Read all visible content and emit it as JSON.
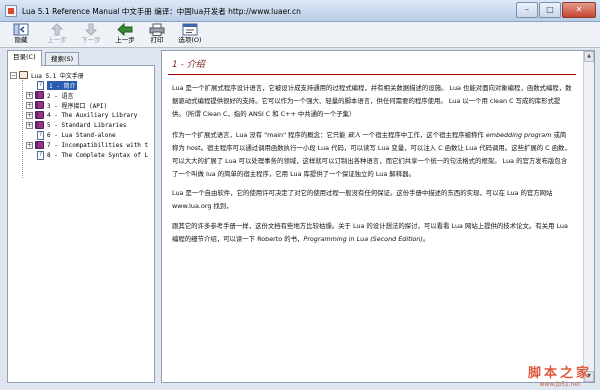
{
  "window": {
    "title": "Lua 5.1 Reference Manual 中文手册 编译：中国lua开发者 http://www.luaer.cn",
    "minimize": "–",
    "maximize": "□",
    "close": "✕"
  },
  "toolbar": {
    "items": [
      {
        "label": "隐藏",
        "icon": "hide-icon",
        "enabled": true
      },
      {
        "label": "上一步",
        "icon": "up-arrow-icon",
        "enabled": false
      },
      {
        "label": "下一步",
        "icon": "down-arrow-icon",
        "enabled": false
      },
      {
        "label": "上一步",
        "icon": "back-arrow-icon",
        "enabled": true
      },
      {
        "label": "打印",
        "icon": "print-icon",
        "enabled": true
      },
      {
        "label": "选项(O)",
        "icon": "options-icon",
        "enabled": true
      }
    ]
  },
  "nav": {
    "tabs": [
      {
        "label": "目录(C)"
      },
      {
        "label": "搜索(S)"
      }
    ],
    "tree": [
      {
        "label": "Lua 5.1 中文手册",
        "type": "root"
      },
      {
        "label": "1 - 简介",
        "type": "page",
        "selected": true
      },
      {
        "label": "2 - 语言",
        "type": "book"
      },
      {
        "label": "3 - 程序接口 (API)",
        "type": "book"
      },
      {
        "label": "4 - The Auxiliary Library",
        "type": "book"
      },
      {
        "label": "5 - Standard Libraries",
        "type": "book"
      },
      {
        "label": "6 - Lua Stand-alone",
        "type": "page"
      },
      {
        "label": "7 - Incompatibilities with t",
        "type": "book"
      },
      {
        "label": "8 - The Complete Syntax of L",
        "type": "page"
      }
    ]
  },
  "content": {
    "heading": "1 - 介绍",
    "p1": "Lua 是一个扩展式程序设计语言，它被设计成支持通用的过程式编程，并有相关数据描述的设施。 Lua 也能对面向对象编程，函数式编程，数据驱动式编程提供很好的支持。它可以作为一个强大、轻量的脚本语言，供任何需要的程序使用。 Lua 以一个用 clean C 写成的库形式提供。（所谓 Clean C，指的 ANSI C 和 C++ 中共通的一个子集）",
    "p2a": "作为一个扩展式语言，Lua 没有 \"main\" 程序的概念：它只能 ",
    "p2b": "嵌入",
    "p2c": " 一个宿主程序中工作，这个宿主程序被称作 ",
    "p2d": "embedding program",
    "p2e": " 或简称为 host。宿主程序可以通过调用函数执行一小段 Lua 代码，可以读写 Lua 变量，可以注入 C 函数让 Lua 代码调用。这些扩展的 C 函数，可以大大的扩展了 Lua 可以处理事务的领域，这样就可以订制出各种语言，而它们共享一个统一的句法格式的框架。 Lua 的官方发布版包含了一个叫做 lua 的简单的宿主程序，它用 Lua 库提供了一个保证独立的 Lua 解释器。",
    "p3": "Lua 是一个自由软件，它的使用许可决定了对它的使用过程一般没有任何保证。这份手册中描述的东西的实现，可以在 Lua 的官方网站 www.lua.org 找到，",
    "p4a": "跟其它的许多参考手册一样，这份文档有些地方比较枯燥。关于 Lua 的设计想法的探讨，可以看看 Lua 网站上提供的技术论文。有关用 Lua 编程的细节介绍，可以读一下 Roberto 的书，",
    "p4b": "Programming in Lua (Second Edition)",
    "p4c": "。"
  },
  "watermark": {
    "main": "脚本之家",
    "sub": "www.jb51.net"
  }
}
